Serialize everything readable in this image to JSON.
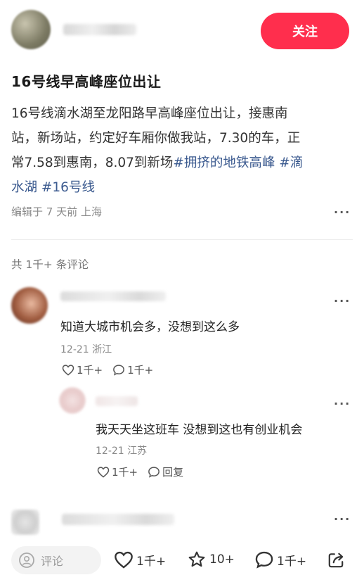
{
  "header": {
    "follow_label": "关注"
  },
  "post": {
    "title": "16号线早高峰座位出让",
    "body_lines": [
      "16号线滴水湖至龙阳路早高峰座位出让，接惠南",
      "站，新场站，约定好车厢你做我站，7.30的车，正",
      "常7.58到惠南，8.07到新场"
    ],
    "tags": [
      "#拥挤的地铁高峰",
      "#滴",
      "水湖",
      "#16号线"
    ],
    "meta": "编辑于 7 天前 上海"
  },
  "comments": {
    "count_label": "共 1千+ 条评论",
    "items": [
      {
        "text": "知道大城市机会多，没想到这么多",
        "date_loc": "12-21 浙江",
        "likes": "1千+",
        "replies": "1千+"
      }
    ],
    "reply": {
      "text": "我天天坐这班车 没想到这也有创业机会",
      "date_loc": "12-21 江苏",
      "likes": "1千+",
      "reply_label": "回复"
    }
  },
  "more_glyph": "···",
  "bottom_bar": {
    "comment_placeholder": "评论",
    "likes": "1千+",
    "stars": "10+",
    "comments": "1千+"
  },
  "icons": [
    "avatar",
    "more-icon",
    "heart-icon",
    "chat-bubble-icon",
    "star-icon",
    "share-icon",
    "emoji-icon"
  ]
}
